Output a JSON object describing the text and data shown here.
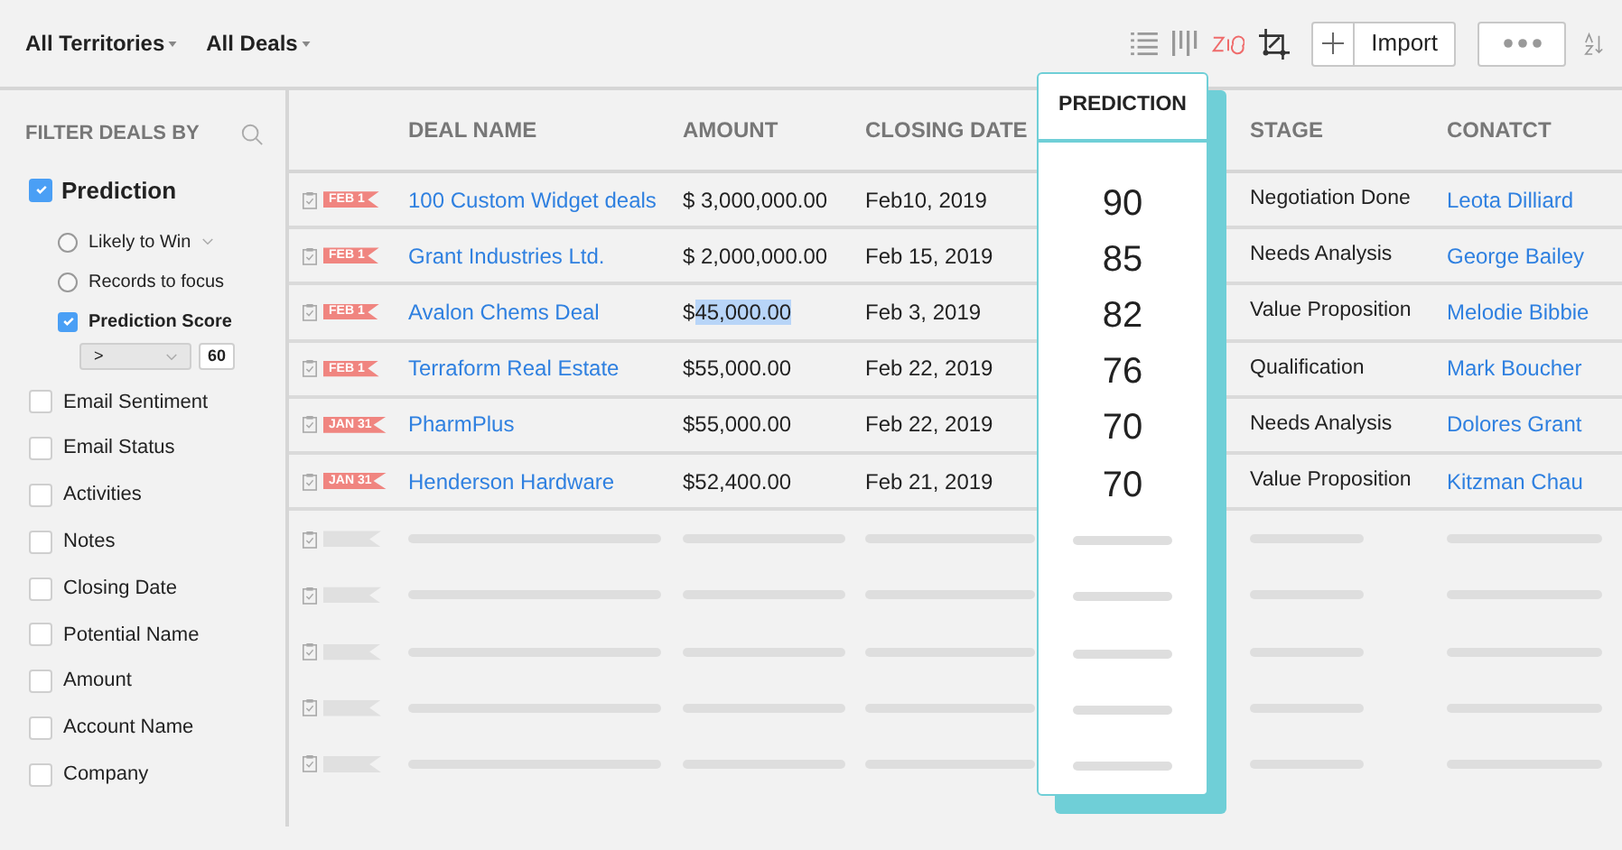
{
  "toolbar": {
    "views": [
      {
        "label": "All Territories"
      },
      {
        "label": "All Deals"
      }
    ],
    "import_button": "Import"
  },
  "sidebar": {
    "title": "FILTER DEALS BY",
    "filters": [
      {
        "label": "Prediction",
        "checked": true,
        "children": [
          {
            "kind": "radio",
            "label": "Likely to Win",
            "selected": false,
            "dropdown": true
          },
          {
            "kind": "radio",
            "label": "Records to focus",
            "selected": false,
            "dropdown": false
          },
          {
            "kind": "checkbox",
            "label": "Prediction Score",
            "checked": true,
            "operator": ">",
            "value": "60"
          }
        ]
      },
      {
        "label": "Email Sentiment",
        "checked": false
      },
      {
        "label": "Email Status",
        "checked": false
      },
      {
        "label": "Activities",
        "checked": false
      },
      {
        "label": "Notes",
        "checked": false
      },
      {
        "label": "Closing Date",
        "checked": false
      },
      {
        "label": "Potential Name",
        "checked": false
      },
      {
        "label": "Amount",
        "checked": false
      },
      {
        "label": "Account Name",
        "checked": false
      },
      {
        "label": "Company",
        "checked": false
      }
    ]
  },
  "table": {
    "columns": [
      "DEAL NAME",
      "AMOUNT",
      "CLOSING DATE",
      "STAGE",
      "CONATCT"
    ],
    "prediction_title": "PREDICTION",
    "rows": [
      {
        "tag": "FEB 1",
        "deal": "100 Custom Widget deals",
        "amount": "$ 3,000,000.00",
        "closing": "Feb10, 2019",
        "prediction": "90",
        "stage": "Negotiation Done",
        "contact": "Leota Dilliard"
      },
      {
        "tag": "FEB 1",
        "deal": "Grant Industries Ltd.",
        "amount": "$ 2,000,000.00",
        "closing": "Feb 15, 2019",
        "prediction": "85",
        "stage": "Needs Analysis",
        "contact": "George Bailey"
      },
      {
        "tag": "FEB 1",
        "deal": "Avalon Chems Deal",
        "amount": "$",
        "amount_selected": "45,000.00",
        "closing": "Feb 3, 2019",
        "prediction": "82",
        "stage": "Value Proposition",
        "contact": "Melodie Bibbie"
      },
      {
        "tag": "FEB 1",
        "deal": "Terraform Real Estate",
        "amount": "$55,000.00",
        "closing": "Feb 22, 2019",
        "prediction": "76",
        "stage": "Qualification",
        "contact": "Mark Boucher"
      },
      {
        "tag": "JAN 31",
        "deal": "PharmPlus",
        "amount": "$55,000.00",
        "closing": "Feb 22, 2019",
        "prediction": "70",
        "stage": "Needs Analysis",
        "contact": "Dolores Grant"
      },
      {
        "tag": "JAN 31",
        "deal": "Henderson Hardware",
        "amount": "$52,400.00",
        "closing": "Feb 21, 2019",
        "prediction": "70",
        "stage": "Value Proposition",
        "contact": "Kitzman Chau"
      }
    ]
  }
}
